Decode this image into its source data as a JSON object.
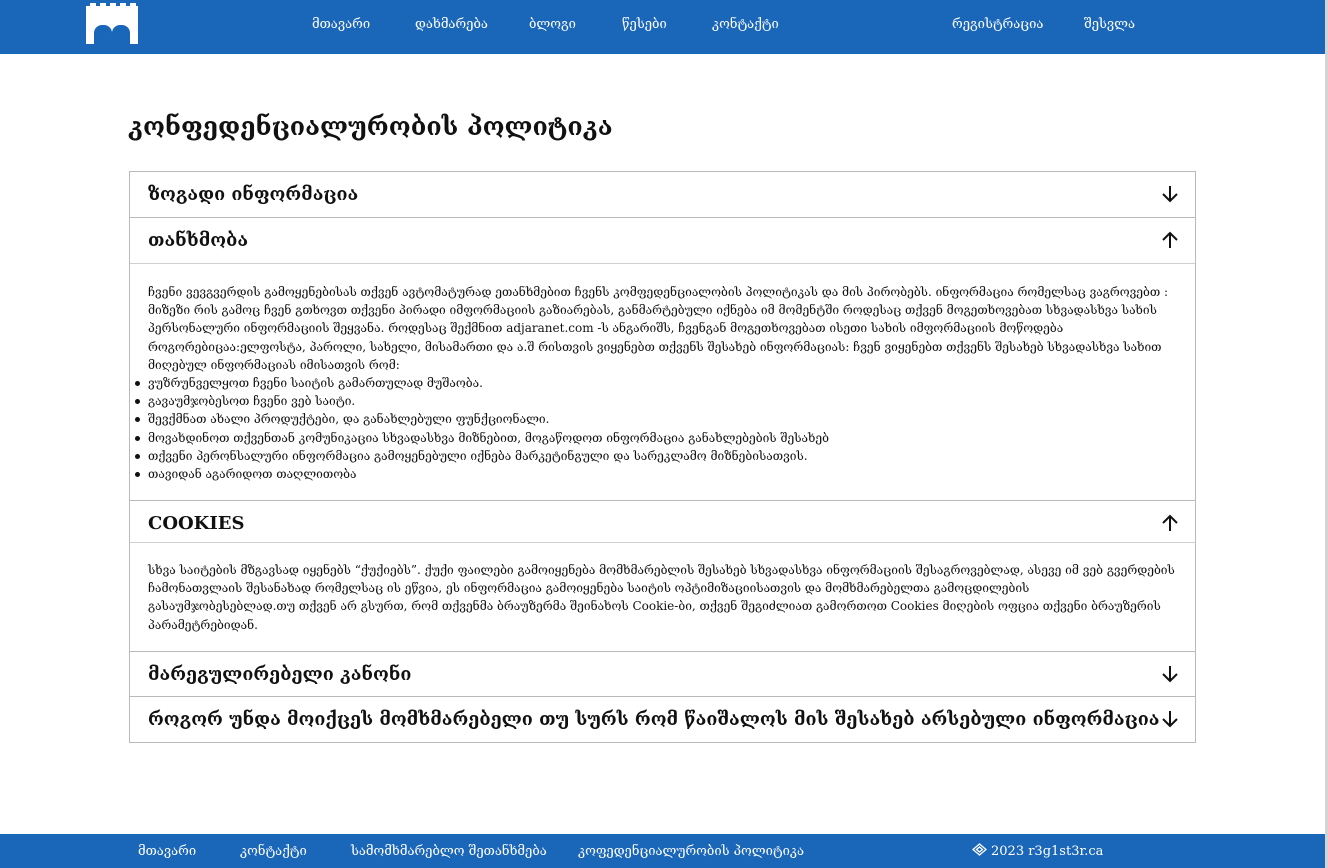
{
  "header": {
    "nav": [
      "მთავარი",
      "დახმარება",
      "ბლოგი",
      "წესები",
      "კონტაქტი"
    ],
    "auth": [
      "რეგისტრაცია",
      "შესვლა"
    ]
  },
  "page": {
    "title": "კონფედენციალურობის პოლიტიკა"
  },
  "sections": [
    {
      "title": "ზოგადი ინფორმაცია",
      "state": "collapsed",
      "icon": "arrow-down-icon"
    },
    {
      "title": "თანხმობა",
      "state": "expanded",
      "icon": "arrow-up-icon",
      "paragraph": "ჩვენი ვევგვერდის გამოყენებისას თქვენ ავტომატურად ეთანხმებით ჩვენს კომფედენციალობის პოლიტიკას და მის პირობებს. ინფორმაცია რომელსაც ვაგროვებთ : მიზეზი რის გამოც ჩვენ გთხოვთ თქვენი პირადი იმფორმაციის გაზიარებას, განმარტებული იქნება იმ მომენტში როდესაც თქვენ მოგეთხოვებათ სხვადასხვა სახის პერსონალური ინფორმაციის შეყვანა. როდესაც შექმნით adjaranet.com -ს ანგარიშს, ჩვენგან მოგეთხოვებათ ისეთი სახის იმფორმაციის მოწოდება როგორებიცაა:ელფოსტა, პაროლი, სახელი, მისამართი და ა.შ რისთვის ვიყენებთ თქვენს შესახებ ინფორმაციას: ჩვენ ვიყენებთ თქვენს შესახებ სხვადასხვა სახით მიღებულ ინფორმაციას იმისათვის რომ:",
      "bullets": [
        "ვუზრუნველყოთ ჩვენი საიტის გამართულად მუშაობა.",
        "გავაუმჯობესოთ ჩვენი ვებ საიტი.",
        "შევქმნათ ახალი პროდუქტები, და განახლებული ფუნქციონალი.",
        "მოვახდინოთ თქვენთან კომუნიკაცია სხვადასხვა მიზნებით, მოგაწოდოთ ინფორმაცია განახლებების შესახებ",
        "თქვენი პერონსალური ინფორმაცია გამოყენებული იქნება მარკეტინგული და სარეკლამო მიზნებისათვის.",
        "თავიდან აგარიდოთ თაღლითობა"
      ]
    },
    {
      "title": "COOKIES",
      "state": "expanded",
      "icon": "arrow-up-icon",
      "paragraph": "სხვა საიტების მზგავსად იყენებს “ქუქიებს”. ქუქი ფაილები გამოიყენება მომხმარებლის შესახებ სხვადასხვა ინფორმაციის შესაგროვებლად, ასევე იმ ვებ გვერდების ჩამონათვლაის შესანახად რომელსაც ის ეწვია, ეს ინფორმაცია გამოიყენება საიტის ოპტიმიზაციისათვის და მომხმარებელთა გამოცდილების გასაუმჯობესებლად.თუ თქვენ არ გსურთ, რომ თქვენმა ბრაუზერმა შეინახოს Cookie-ბი, თქვენ შეგიძლიათ გამორთოთ Cookies მიღების ოფცია თქვენი ბრაუზერის პარამეტრებიდან."
    },
    {
      "title": "მარეგულირებელი კანონი",
      "state": "collapsed",
      "icon": "arrow-down-icon"
    },
    {
      "title": "როგორ უნდა მოიქცეს მომხმარებელი თუ სურს რომ წაიშალოს მის შესახებ არსებული ინფორმაცია",
      "state": "collapsed",
      "icon": "arrow-down-icon"
    }
  ],
  "footer": {
    "links": [
      "მთავარი",
      "კონტაქტი",
      "სამომხმარებლო შეთანხმება",
      "კოფედენციალურობის პოლიტიკა"
    ],
    "copyright": "2023 r3g1st3r.ca",
    "copyright_icon": "diamond-logo-icon"
  },
  "colors": {
    "brand": "#1a66b8",
    "text": "#111111",
    "border": "#b9b9b9"
  }
}
